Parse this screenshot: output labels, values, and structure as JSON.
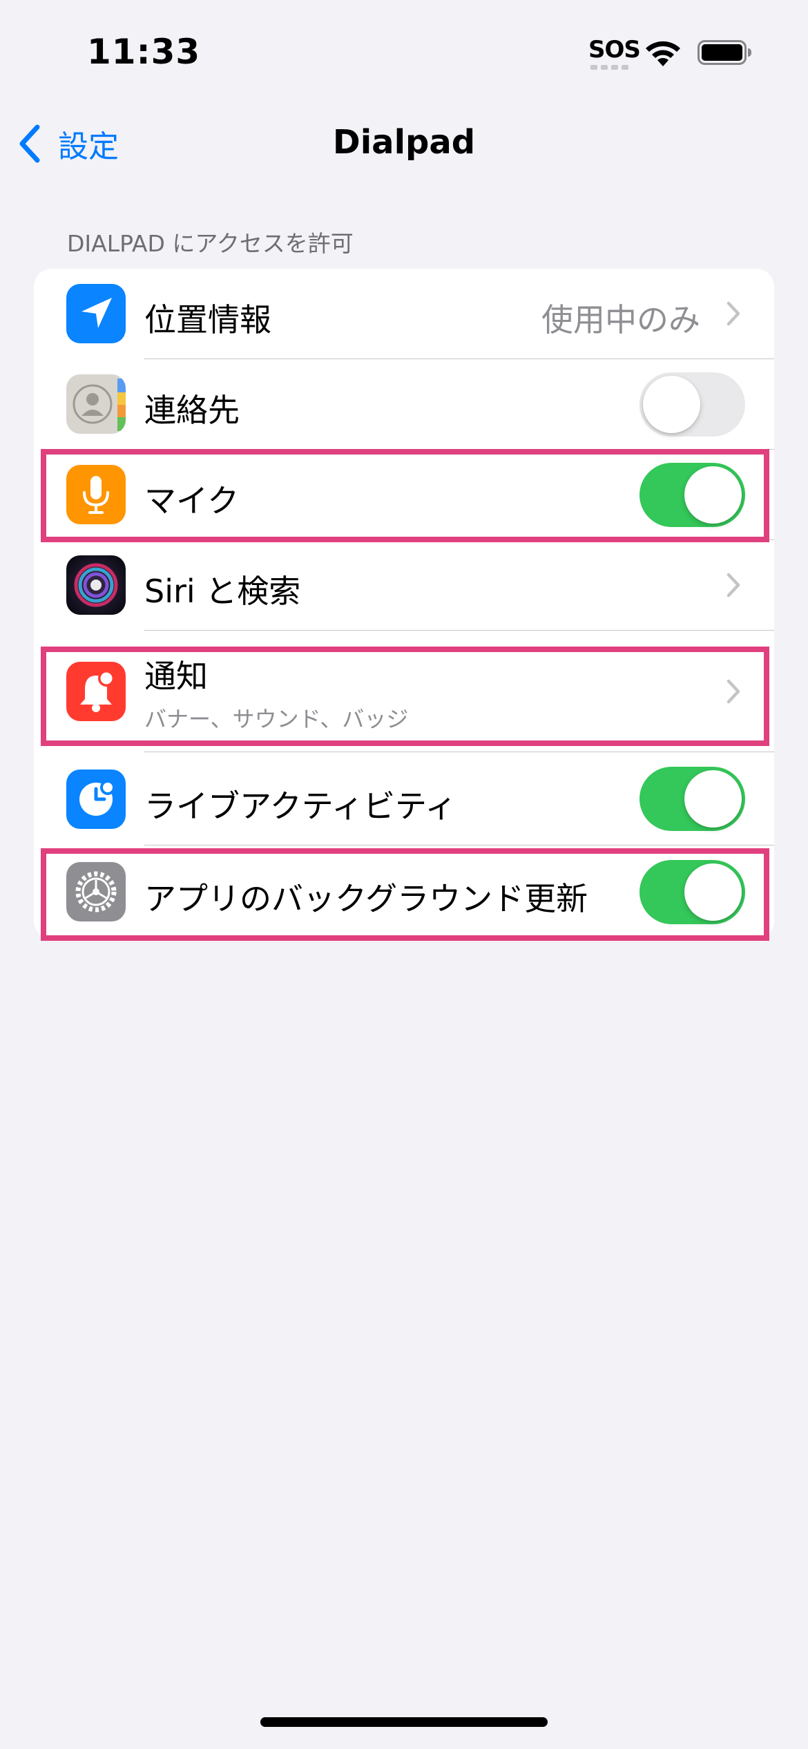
{
  "status_bar": {
    "time": "11:33",
    "sos": "SOS",
    "wifi_icon": "wifi-icon",
    "battery_icon": "battery-icon"
  },
  "nav": {
    "back_label": "設定",
    "title": "Dialpad"
  },
  "section": {
    "header": "DIALPAD にアクセスを許可"
  },
  "rows": [
    {
      "label": "位置情報",
      "value": "使用中のみ",
      "icon": "location-arrow-icon",
      "accessory": "chevron"
    },
    {
      "label": "連絡先",
      "icon": "contacts-icon",
      "accessory": "toggle",
      "toggle_on": false
    },
    {
      "label": "マイク",
      "icon": "microphone-icon",
      "accessory": "toggle",
      "toggle_on": true,
      "highlighted": true
    },
    {
      "label": "Siri と検索",
      "icon": "siri-icon",
      "accessory": "chevron"
    },
    {
      "label": "通知",
      "sublabel": "バナー、サウンド、バッジ",
      "icon": "notification-bell-icon",
      "accessory": "chevron",
      "highlighted": true
    },
    {
      "label": "ライブアクティビティ",
      "icon": "live-activity-icon",
      "accessory": "toggle",
      "toggle_on": true
    },
    {
      "label": "アプリのバックグラウンド更新",
      "icon": "gear-icon",
      "accessory": "toggle",
      "toggle_on": true,
      "highlighted": true
    }
  ],
  "colors": {
    "accent": "#007aff",
    "toggle_on": "#34c759",
    "highlight": "#e0407e",
    "background": "#f2f2f7"
  }
}
